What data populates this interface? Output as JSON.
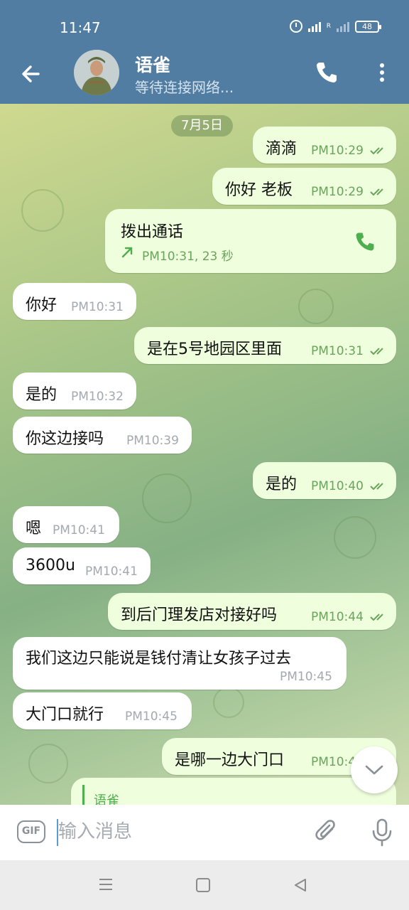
{
  "status_bar": {
    "time": "11:47",
    "signal_label": "R",
    "battery": "48"
  },
  "header": {
    "title": "语雀",
    "subtitle": "等待连接网络..."
  },
  "chat": {
    "date": "7月5日",
    "messages": [
      {
        "dir": "out",
        "text": "滴滴",
        "time": "PM10:29",
        "read": true
      },
      {
        "dir": "out",
        "text": "你好 老板",
        "time": "PM10:29",
        "read": true
      },
      {
        "dir": "call",
        "text": "拨出通话",
        "detail": "PM10:31, 23 秒"
      },
      {
        "dir": "in",
        "text": "你好",
        "time": "PM10:31"
      },
      {
        "dir": "out",
        "text": "是在5号地园区里面",
        "time": "PM10:31",
        "read": true
      },
      {
        "dir": "in",
        "text": "是的",
        "time": "PM10:32"
      },
      {
        "dir": "in",
        "text": "你这边接吗",
        "time": "PM10:39"
      },
      {
        "dir": "out",
        "text": "是的",
        "time": "PM10:40",
        "read": true
      },
      {
        "dir": "in",
        "text": "嗯",
        "time": "PM10:41"
      },
      {
        "dir": "in",
        "text": "3600u",
        "time": "PM10:41"
      },
      {
        "dir": "out",
        "text": "到后门理发店对接好吗",
        "time": "PM10:44",
        "read": true
      },
      {
        "dir": "in",
        "text": "我们这边只能说是钱付清让女孩子过去",
        "time": "PM10:45"
      },
      {
        "dir": "in",
        "text": "大门口就行",
        "time": "PM10:45"
      },
      {
        "dir": "out",
        "text": "是哪一边大门口",
        "time": "PM10:4"
      },
      {
        "dir": "reply",
        "text": "语雀"
      }
    ]
  },
  "input": {
    "placeholder": "输入消息",
    "gif_label": "GIF"
  },
  "colors": {
    "header": "#517da2",
    "outgoing": "#effedd",
    "incoming": "#ffffff",
    "accent": "#4fae4e"
  }
}
